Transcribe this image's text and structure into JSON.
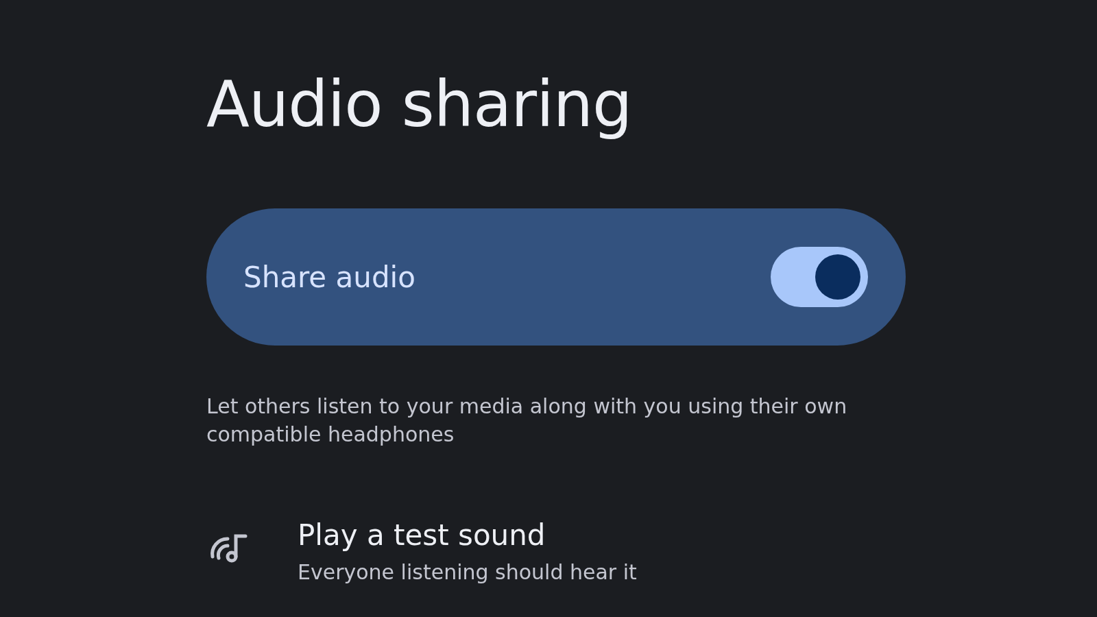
{
  "title": "Audio sharing",
  "share_audio": {
    "label": "Share audio",
    "on": true
  },
  "description": "Let others listen to your media along with you using their own compatible headphones",
  "test_sound": {
    "title": "Play a test sound",
    "subtitle": "Everyone listening should hear it"
  }
}
